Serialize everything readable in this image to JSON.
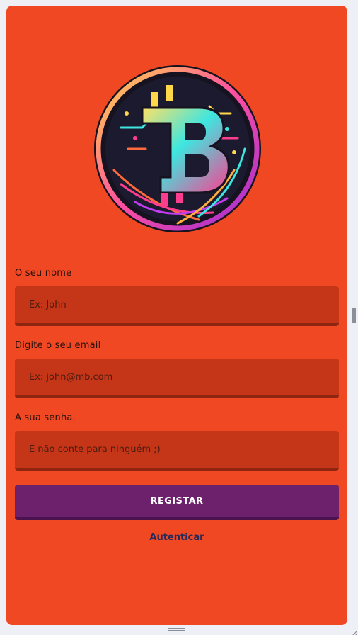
{
  "form": {
    "name_label": "O seu nome",
    "name_placeholder": "Ex: John",
    "email_label": "Digite o seu email",
    "email_placeholder": "Ex: john@mb.com",
    "password_label": "A sua senha.",
    "password_placeholder": "E não conte para ninguém ;)",
    "submit_label": "REGISTAR",
    "login_link": "Autenticar"
  },
  "logo": {
    "icon": "bitcoin-logo-icon"
  },
  "colors": {
    "card_background": "#f04823",
    "input_background": "#c43617",
    "button_background": "#6d216c",
    "link_color": "#2a2a5a"
  }
}
